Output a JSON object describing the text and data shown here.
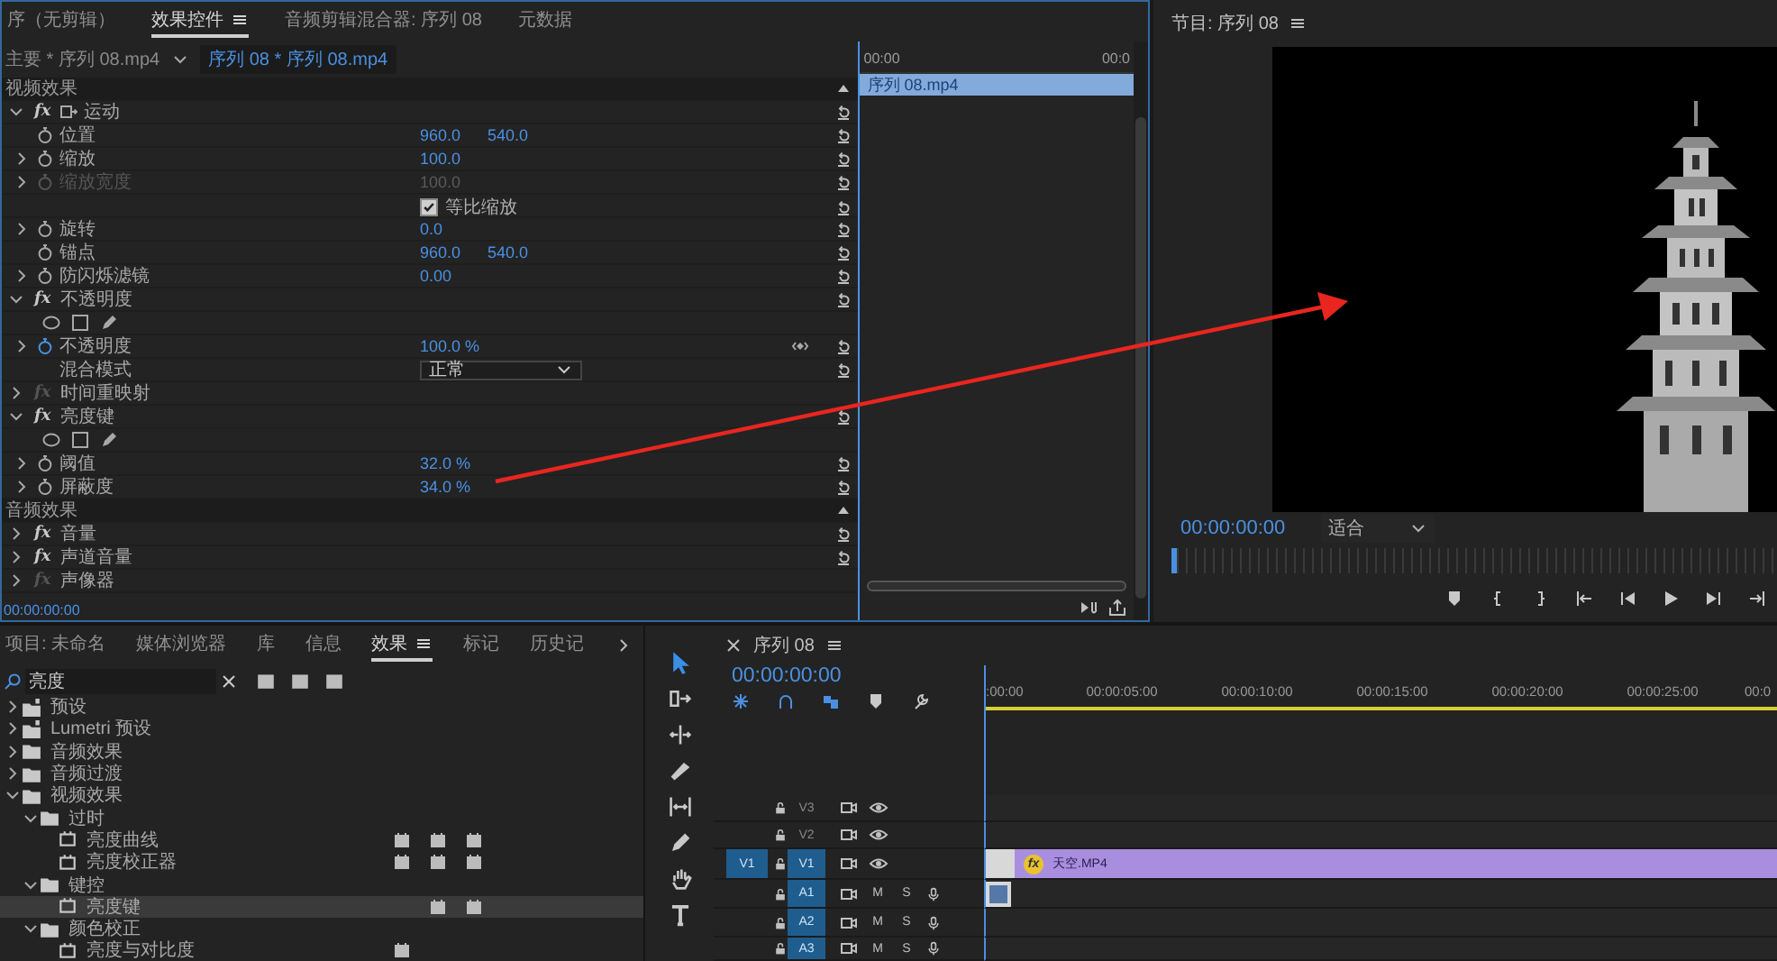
{
  "annotation_arrow": true,
  "effect_controls": {
    "tabs": [
      {
        "label": "序（无剪辑）",
        "selected": false,
        "menu": false
      },
      {
        "label": "效果控件",
        "selected": true,
        "menu": true
      },
      {
        "label": "音频剪辑混合器: 序列 08",
        "selected": false,
        "menu": false
      },
      {
        "label": "元数据",
        "selected": false,
        "menu": false
      }
    ],
    "master_clip": "主要 * 序列 08.mp4",
    "sequence_clip": "序列 08 * 序列 08.mp4",
    "rows": [
      {
        "kind": "section",
        "name": "视频效果"
      },
      {
        "kind": "transform_effect",
        "name": "运动",
        "fx": "fx",
        "expanded": true,
        "enabled": true,
        "reset": true
      },
      {
        "kind": "property",
        "name": "位置",
        "values": [
          "960.0",
          "540.0"
        ],
        "expandable": false,
        "disabled": false,
        "animated": false,
        "keyframes": false,
        "reset": true
      },
      {
        "kind": "property",
        "name": "缩放",
        "values": [
          "100.0"
        ],
        "expandable": true,
        "disabled": false,
        "animated": false,
        "keyframes": false,
        "reset": true
      },
      {
        "kind": "property",
        "name": "缩放宽度",
        "values": [
          "100.0"
        ],
        "expandable": true,
        "disabled": true,
        "animated": false,
        "keyframes": false,
        "reset": true
      },
      {
        "kind": "checkbox",
        "label": "等比缩放",
        "checked": true,
        "reset": true
      },
      {
        "kind": "property",
        "name": "旋转",
        "values": [
          "0.0"
        ],
        "expandable": true,
        "disabled": false,
        "animated": false,
        "keyframes": false,
        "reset": true
      },
      {
        "kind": "property",
        "name": "锚点",
        "values": [
          "960.0",
          "540.0"
        ],
        "expandable": false,
        "disabled": false,
        "animated": false,
        "keyframes": false,
        "reset": true
      },
      {
        "kind": "property",
        "name": "防闪烁滤镜",
        "values": [
          "0.00"
        ],
        "expandable": true,
        "disabled": false,
        "animated": false,
        "keyframes": false,
        "reset": true
      },
      {
        "kind": "effect",
        "name": "不透明度",
        "fx": "fx",
        "expanded": true,
        "enabled": true,
        "reset": true
      },
      {
        "kind": "masks"
      },
      {
        "kind": "property",
        "name": "不透明度",
        "values": [
          "100.0 %"
        ],
        "expandable": true,
        "disabled": false,
        "animated": true,
        "keyframes": true,
        "reset": true
      },
      {
        "kind": "dropdown",
        "name": "混合模式",
        "value": "正常",
        "reset": true
      },
      {
        "kind": "effect",
        "name": "时间重映射",
        "fx": "fx",
        "expanded": false,
        "enabled": false,
        "reset": false
      },
      {
        "kind": "effect",
        "name": "亮度键",
        "fx": "fx",
        "expanded": true,
        "enabled": true,
        "reset": true
      },
      {
        "kind": "masks"
      },
      {
        "kind": "property",
        "name": "阈值",
        "values": [
          "32.0 %"
        ],
        "expandable": true,
        "disabled": false,
        "animated": false,
        "keyframes": false,
        "reset": true
      },
      {
        "kind": "property",
        "name": "屏蔽度",
        "values": [
          "34.0 %"
        ],
        "expandable": true,
        "disabled": false,
        "animated": false,
        "keyframes": false,
        "reset": true
      },
      {
        "kind": "section",
        "name": "音频效果"
      },
      {
        "kind": "effect",
        "name": "音量",
        "fx": "fx",
        "expanded": false,
        "enabled": true,
        "reset": true
      },
      {
        "kind": "effect",
        "name": "声道音量",
        "fx": "fx",
        "expanded": false,
        "enabled": true,
        "reset": true
      },
      {
        "kind": "effect",
        "name": "声像器",
        "fx": "fx",
        "expanded": false,
        "enabled": false,
        "reset": false
      }
    ],
    "mini_timeline": {
      "ruler": [
        "00:00",
        "00:0"
      ],
      "clip": "序列 08.mp4"
    },
    "timecode": "00:00:00:00"
  },
  "program_monitor": {
    "title": "节目: 序列 08",
    "menu": true,
    "timecode": "00:00:00:00",
    "zoom": "适合"
  },
  "effects_panel": {
    "tabs": [
      {
        "label": "项目: 未命名",
        "selected": false,
        "menu": false
      },
      {
        "label": "媒体浏览器",
        "selected": false,
        "menu": false
      },
      {
        "label": "库",
        "selected": false,
        "menu": false
      },
      {
        "label": "信息",
        "selected": false,
        "menu": false
      },
      {
        "label": "效果",
        "selected": true,
        "menu": true
      },
      {
        "label": "标记",
        "selected": false,
        "menu": false
      },
      {
        "label": "历史记",
        "selected": false,
        "menu": false
      }
    ],
    "search": {
      "value": "亮度"
    },
    "tree": [
      {
        "kind": "preset_folder",
        "label": "预设",
        "expanded": false,
        "selected": false
      },
      {
        "kind": "preset_folder",
        "label": "Lumetri 预设",
        "expanded": false,
        "selected": false
      },
      {
        "kind": "folder",
        "label": "音频效果",
        "expanded": false,
        "selected": false
      },
      {
        "kind": "folder",
        "label": "音频过渡",
        "expanded": false,
        "selected": false
      },
      {
        "kind": "folder",
        "label": "视频效果",
        "expanded": true,
        "selected": false,
        "children": [
          {
            "kind": "folder",
            "label": "过时",
            "expanded": true,
            "selected": false,
            "children": [
              {
                "kind": "effect",
                "label": "亮度曲线",
                "accelerated": true,
                "bit32": true,
                "yuv": true,
                "selected": false
              },
              {
                "kind": "effect",
                "label": "亮度校正器",
                "accelerated": true,
                "bit32": true,
                "yuv": true,
                "selected": false
              }
            ]
          },
          {
            "kind": "folder",
            "label": "键控",
            "expanded": true,
            "selected": false,
            "children": [
              {
                "kind": "effect",
                "label": "亮度键",
                "accelerated": false,
                "bit32": true,
                "yuv": true,
                "selected": true
              }
            ]
          },
          {
            "kind": "folder",
            "label": "颜色校正",
            "expanded": true,
            "selected": false,
            "children": [
              {
                "kind": "effect",
                "label": "亮度与对比度",
                "accelerated": true,
                "bit32": false,
                "yuv": false,
                "selected": false
              }
            ]
          }
        ]
      }
    ]
  },
  "tools": [
    {
      "kind": "select",
      "selected": true
    },
    {
      "kind": "track_select",
      "selected": false
    },
    {
      "kind": "ripple",
      "selected": false
    },
    {
      "kind": "razor",
      "selected": false
    },
    {
      "kind": "slip",
      "selected": false
    },
    {
      "kind": "pen",
      "selected": false
    },
    {
      "kind": "hand",
      "selected": false
    },
    {
      "kind": "type",
      "selected": false
    }
  ],
  "timeline": {
    "title": "序列 08",
    "timecode": "00:00:00:00",
    "ruler": [
      ":00:00",
      "00:00:05:00",
      "00:00:10:00",
      "00:00:15:00",
      "00:00:20:00",
      "00:00:25:00",
      "00:0"
    ],
    "tracks": [
      {
        "kind": "video",
        "label": "V3",
        "targeted": false
      },
      {
        "kind": "video",
        "label": "V2",
        "targeted": false
      },
      {
        "kind": "video",
        "label": "V1",
        "targeted": true,
        "source": "V1",
        "clip": {
          "label": "天空.MP4",
          "fx": "fx"
        }
      },
      {
        "kind": "audio",
        "label": "A1",
        "targeted": true,
        "mute": "M",
        "solo": "S",
        "clip_stub": true
      },
      {
        "kind": "audio",
        "label": "A2",
        "targeted": true,
        "mute": "M",
        "solo": "S"
      },
      {
        "kind": "audio",
        "label": "A3",
        "targeted": true,
        "mute": "M",
        "solo": "S"
      }
    ]
  }
}
